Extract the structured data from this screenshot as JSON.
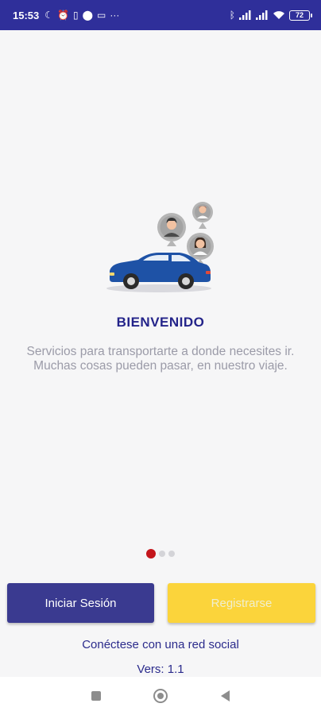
{
  "status_bar": {
    "time": "15:53",
    "battery": "72",
    "left_icons": [
      "moon-icon",
      "alarm-icon",
      "vibrate-icon",
      "location-icon",
      "laptop-icon",
      "more-icon"
    ],
    "right_icons": [
      "bluetooth-icon",
      "signal-icon",
      "signal-icon",
      "wifi-icon",
      "battery-icon"
    ]
  },
  "welcome": {
    "title": "BIENVENIDO",
    "description": "Servicios para transportarte a donde necesites ir. Muchas cosas pueden pasar, en nuestro viaje."
  },
  "pager": {
    "total": 3,
    "active": 0
  },
  "buttons": {
    "login": "Iniciar Sesión",
    "register": "Registrarse"
  },
  "social_link": "Conéctese con una red social",
  "version": "Vers: 1.1",
  "colors": {
    "primary": "#2f2f9a",
    "accent_yellow": "#fbd43b",
    "active_dot": "#c4161c",
    "car_blue": "#1e52a6"
  },
  "nav_bar": [
    "recents-button",
    "home-button",
    "back-button"
  ]
}
